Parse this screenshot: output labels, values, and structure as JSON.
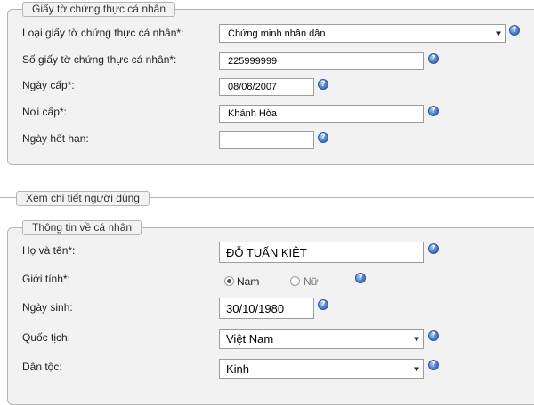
{
  "section_identity": {
    "legend": "Giấy tờ chứng thực cá nhân",
    "doc_type_label": "Loại giấy tờ chứng thực cá nhân*:",
    "doc_type_value": "Chứng minh nhân dân",
    "doc_number_label": "Số giấy tờ chứng thực cá nhân*:",
    "doc_number_value": "225999999",
    "issue_date_label": "Ngày cấp*:",
    "issue_date_value": "08/08/2007",
    "issue_place_label": "Nơi cấp*:",
    "issue_place_value": "Khánh Hòa",
    "expiry_label": "Ngày hết hạn:",
    "expiry_value": ""
  },
  "section_view": {
    "legend": "Xem chi tiết người dùng"
  },
  "section_personal": {
    "legend": "Thông tin về cá nhân",
    "fullname_label": "Họ và tên*:",
    "fullname_value": "ĐỖ TUẤN KIỆT",
    "gender_label": "Giới tính*:",
    "gender_male": "Nam",
    "gender_female": "Nữ",
    "gender_selected": "Nam",
    "birthdate_label": "Ngày sinh:",
    "birthdate_value": "30/10/1980",
    "nationality_label": "Quốc tịch:",
    "nationality_value": "Việt Nam",
    "ethnicity_label": "Dân tộc:",
    "ethnicity_value": "Kinh"
  },
  "help_glyph": "?"
}
